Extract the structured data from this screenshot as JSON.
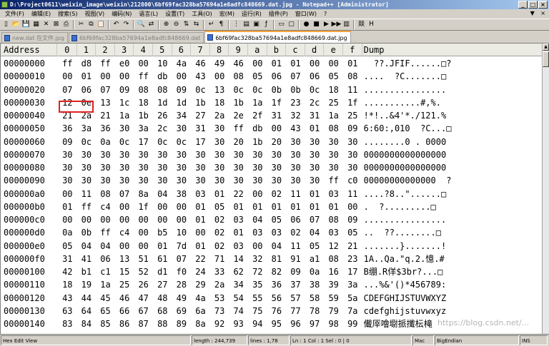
{
  "window": {
    "title": "D:\\Project0611\\weixin_image\\weixin\\212800\\6bf69fac328ba57694a1e8adfc848669.dat.jpg - Notepad++ [Administrator]",
    "controls": {
      "minimize": "_",
      "maximize": "□",
      "close": "×"
    }
  },
  "menu": {
    "items": [
      "文件(F)",
      "编辑(E)",
      "搜索(S)",
      "视图(V)",
      "编码(N)",
      "语言(L)",
      "设置(T)",
      "工具(O)",
      "宏(M)",
      "运行(R)",
      "插件(P)",
      "窗口(W)",
      "?"
    ],
    "right_controls": "▼ × "
  },
  "toolbar": {
    "icons": [
      "new-icon",
      "open-icon",
      "save-icon",
      "save-all-icon",
      "close-icon",
      "close-all-icon",
      "print-icon",
      "cut-icon",
      "copy-icon",
      "paste-icon",
      "undo-icon",
      "redo-icon",
      "find-icon",
      "replace-icon",
      "zoom-in-icon",
      "zoom-out-icon",
      "sync-v-icon",
      "sync-h-icon",
      "wrap-icon",
      "all-chars-icon",
      "indent-guide-icon",
      "udl-icon",
      "doc-map-icon",
      "func-list-icon",
      "folder-icon",
      "monitor-icon",
      "record-icon",
      "stop-icon",
      "play-icon",
      "play-multi-icon",
      "save-macro-icon",
      "spell-icon",
      "hex-icon"
    ],
    "glyphs": [
      "▯",
      "📂",
      "💾",
      "▦",
      "✕",
      "⊠",
      "⎙",
      "✂",
      "⧉",
      "📋",
      "↶",
      "↷",
      "🔍",
      "⇄",
      "⊕",
      "⊖",
      "⇅",
      "⇆",
      "↵",
      "¶",
      "⋮",
      "▤",
      "▣",
      "ƒ",
      "▭",
      "▢",
      "●",
      "■",
      "▶",
      "▶▶",
      "▥",
      "燚",
      "H"
    ]
  },
  "tabs": [
    {
      "label": "new.dat 在文件.jpg",
      "active": false
    },
    {
      "label": "6bf69fac328ba57694a1e8adfc848669.dat",
      "active": false
    },
    {
      "label": "6bf69fac328ba57694a1e8adfc848669.dat.jpg",
      "active": true
    }
  ],
  "hex": {
    "header": {
      "address": "Address",
      "columns": [
        "0",
        "1",
        "2",
        "3",
        "4",
        "5",
        "6",
        "7",
        "8",
        "9",
        "a",
        "b",
        "c",
        "d",
        "e",
        "f"
      ],
      "dump": "Dump"
    },
    "rows": [
      {
        "addr": "00000000",
        "bytes": [
          "ff",
          "d8",
          "ff",
          "e0",
          "00",
          "10",
          "4a",
          "46",
          "49",
          "46",
          "00",
          "01",
          "01",
          "00",
          "00",
          "01"
        ],
        "dump": "  ??.JFIF......□?"
      },
      {
        "addr": "00000010",
        "bytes": [
          "00",
          "01",
          "00",
          "00",
          "ff",
          "db",
          "00",
          "43",
          "00",
          "08",
          "05",
          "06",
          "07",
          "06",
          "05",
          "08"
        ],
        "dump": "....  ?C.......□"
      },
      {
        "addr": "00000020",
        "bytes": [
          "07",
          "06",
          "07",
          "09",
          "08",
          "08",
          "09",
          "0c",
          "13",
          "0c",
          "0c",
          "0b",
          "0b",
          "0c",
          "18",
          "11"
        ],
        "dump": "................"
      },
      {
        "addr": "00000030",
        "bytes": [
          "12",
          "0e",
          "13",
          "1c",
          "18",
          "1d",
          "1d",
          "1b",
          "18",
          "1b",
          "1a",
          "1f",
          "23",
          "2c",
          "25",
          "1f"
        ],
        "dump": "...........#,%."
      },
      {
        "addr": "00000040",
        "bytes": [
          "21",
          "2a",
          "21",
          "1a",
          "1b",
          "26",
          "34",
          "27",
          "2a",
          "2e",
          "2f",
          "31",
          "32",
          "31",
          "1a",
          "25"
        ],
        "dump": "!*!..&4'*./121.%"
      },
      {
        "addr": "00000050",
        "bytes": [
          "36",
          "3a",
          "36",
          "30",
          "3a",
          "2c",
          "30",
          "31",
          "30",
          "ff",
          "db",
          "00",
          "43",
          "01",
          "08",
          "09"
        ],
        "dump": "6:60:,010  ?C...□"
      },
      {
        "addr": "00000060",
        "bytes": [
          "09",
          "0c",
          "0a",
          "0c",
          "17",
          "0c",
          "0c",
          "17",
          "30",
          "20",
          "1b",
          "20",
          "30",
          "30",
          "30",
          "30"
        ],
        "dump": "........0 . 0000"
      },
      {
        "addr": "00000070",
        "bytes": [
          "30",
          "30",
          "30",
          "30",
          "30",
          "30",
          "30",
          "30",
          "30",
          "30",
          "30",
          "30",
          "30",
          "30",
          "30",
          "30"
        ],
        "dump": "0000000000000000"
      },
      {
        "addr": "00000080",
        "bytes": [
          "30",
          "30",
          "30",
          "30",
          "30",
          "30",
          "30",
          "30",
          "30",
          "30",
          "30",
          "30",
          "30",
          "30",
          "30",
          "30"
        ],
        "dump": "0000000000000000"
      },
      {
        "addr": "00000090",
        "bytes": [
          "30",
          "30",
          "30",
          "30",
          "30",
          "30",
          "30",
          "30",
          "30",
          "30",
          "30",
          "30",
          "30",
          "30",
          "ff",
          "c0"
        ],
        "dump": "00000000000000  ?"
      },
      {
        "addr": "000000a0",
        "bytes": [
          "00",
          "11",
          "08",
          "07",
          "8a",
          "04",
          "38",
          "03",
          "01",
          "22",
          "00",
          "02",
          "11",
          "01",
          "03",
          "11"
        ],
        "dump": "....?8..\"......□"
      },
      {
        "addr": "000000b0",
        "bytes": [
          "01",
          "ff",
          "c4",
          "00",
          "1f",
          "00",
          "00",
          "01",
          "05",
          "01",
          "01",
          "01",
          "01",
          "01",
          "01",
          "00"
        ],
        "dump": ".  ?.........□"
      },
      {
        "addr": "000000c0",
        "bytes": [
          "00",
          "00",
          "00",
          "00",
          "00",
          "00",
          "00",
          "01",
          "02",
          "03",
          "04",
          "05",
          "06",
          "07",
          "08",
          "09"
        ],
        "dump": "................"
      },
      {
        "addr": "000000d0",
        "bytes": [
          "0a",
          "0b",
          "ff",
          "c4",
          "00",
          "b5",
          "10",
          "00",
          "02",
          "01",
          "03",
          "03",
          "02",
          "04",
          "03",
          "05"
        ],
        "dump": "..  ??........□"
      },
      {
        "addr": "000000e0",
        "bytes": [
          "05",
          "04",
          "04",
          "00",
          "00",
          "01",
          "7d",
          "01",
          "02",
          "03",
          "00",
          "04",
          "11",
          "05",
          "12",
          "21"
        ],
        "dump": ".......}.......!"
      },
      {
        "addr": "000000f0",
        "bytes": [
          "31",
          "41",
          "06",
          "13",
          "51",
          "61",
          "07",
          "22",
          "71",
          "14",
          "32",
          "81",
          "91",
          "a1",
          "08",
          "23"
        ],
        "dump": "1A..Qa.\"q.2.憶.#"
      },
      {
        "addr": "00000100",
        "bytes": [
          "42",
          "b1",
          "c1",
          "15",
          "52",
          "d1",
          "f0",
          "24",
          "33",
          "62",
          "72",
          "82",
          "09",
          "0a",
          "16",
          "17"
        ],
        "dump": "B绷.R佯$3br?...□"
      },
      {
        "addr": "00000110",
        "bytes": [
          "18",
          "19",
          "1a",
          "25",
          "26",
          "27",
          "28",
          "29",
          "2a",
          "34",
          "35",
          "36",
          "37",
          "38",
          "39",
          "3a"
        ],
        "dump": "...%&'()*456789:"
      },
      {
        "addr": "00000120",
        "bytes": [
          "43",
          "44",
          "45",
          "46",
          "47",
          "48",
          "49",
          "4a",
          "53",
          "54",
          "55",
          "56",
          "57",
          "58",
          "59",
          "5a"
        ],
        "dump": "CDEFGHIJSTUVWXYZ"
      },
      {
        "addr": "00000130",
        "bytes": [
          "63",
          "64",
          "65",
          "66",
          "67",
          "68",
          "69",
          "6a",
          "73",
          "74",
          "75",
          "76",
          "77",
          "78",
          "79",
          "7a"
        ],
        "dump": "cdefghijstuvwxyz"
      },
      {
        "addr": "00000140",
        "bytes": [
          "83",
          "84",
          "85",
          "86",
          "87",
          "88",
          "89",
          "8a",
          "92",
          "93",
          "94",
          "95",
          "96",
          "97",
          "98",
          "99"
        ],
        "dump": "儎厗噲墛挀攕枟槞"
      }
    ]
  },
  "scrollbar": {
    "up_arrow": "▲"
  },
  "status": {
    "file_type": "Hex Edit View",
    "length": "length : 244,739",
    "lines": "lines : 1,78",
    "ln_col": "Ln : 1    Col : 1    Sel : 0 | 0",
    "eol": "Mac",
    "encoding": "BigEndian",
    "mode": "INS"
  },
  "watermark": "https://blog.csdn.net/..."
}
